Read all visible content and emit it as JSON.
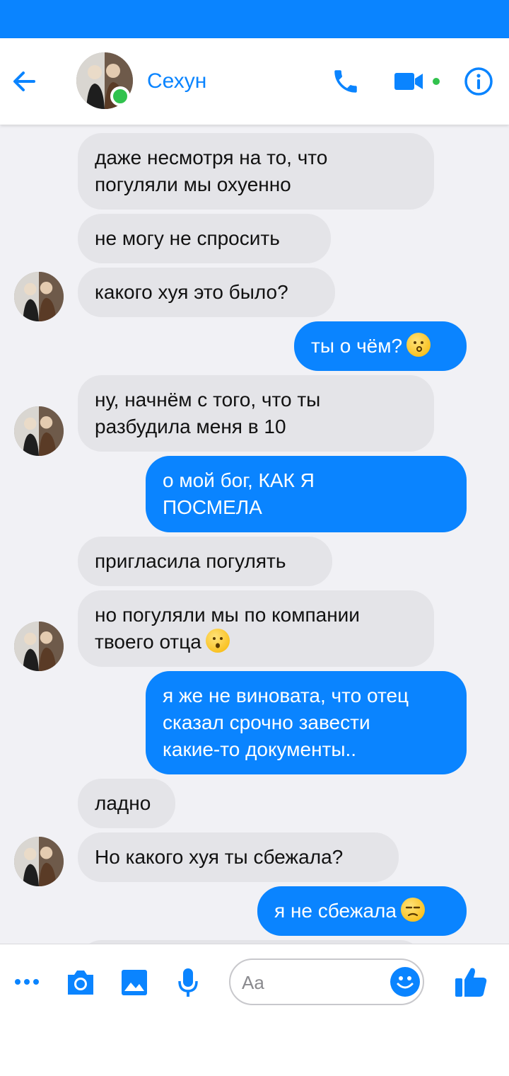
{
  "header": {
    "contact_name": "Сехун",
    "back_icon": "arrow-left-icon",
    "call_icon": "phone-icon",
    "video_icon": "video-camera-icon",
    "info_icon": "info-icon",
    "online": true
  },
  "colors": {
    "accent": "#0a84ff",
    "incoming_bubble": "#e4e4e8",
    "online": "#31c24d",
    "chat_bg": "#f1f1f5"
  },
  "messages": [
    {
      "side": "in",
      "lines": [
        "даже несмотря на то, что",
        "погуляли мы охуенно"
      ]
    },
    {
      "side": "in",
      "lines": [
        "не могу не спросить"
      ]
    },
    {
      "side": "in",
      "lines": [
        "какого хуя это было?"
      ]
    },
    {
      "side": "out",
      "lines": [
        "ты о чём?"
      ],
      "emoji": "kissing-face"
    },
    {
      "side": "in",
      "lines": [
        "ну, начнём с того, что ты",
        "разбудила меня в 10"
      ]
    },
    {
      "side": "out",
      "lines": [
        "о мой бог, КАК Я",
        "ПОСМЕЛА"
      ]
    },
    {
      "side": "in",
      "lines": [
        "пригласила погулять"
      ]
    },
    {
      "side": "in",
      "lines": [
        "но погуляли мы по компании",
        "твоего отца"
      ],
      "emoji": "hushed-face"
    },
    {
      "side": "out",
      "lines": [
        "я же не виновата, что отец",
        "сказал срочно завести",
        "какие-то документы.."
      ]
    },
    {
      "side": "in",
      "lines": [
        "ладно"
      ]
    },
    {
      "side": "in",
      "lines": [
        "Но какого хуя ты сбежала?"
      ]
    },
    {
      "side": "out",
      "lines": [
        "я не сбежала"
      ],
      "emoji": "unamused-face"
    }
  ],
  "composer": {
    "placeholder": "Aa",
    "more_icon": "more-dots-icon",
    "camera_icon": "camera-icon",
    "gallery_icon": "image-icon",
    "mic_icon": "microphone-icon",
    "emoji_icon": "smiley-icon",
    "like_icon": "thumbs-up-icon"
  }
}
